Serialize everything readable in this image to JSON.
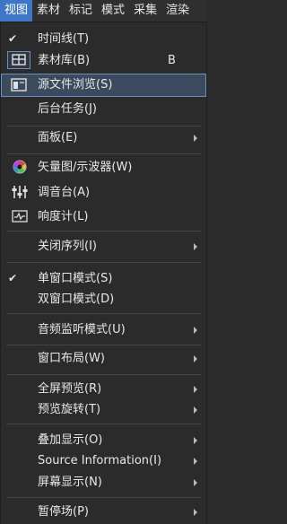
{
  "menubar": {
    "items": [
      "视图",
      "素材",
      "标记",
      "模式",
      "采集",
      "渲染"
    ],
    "active_index": 0
  },
  "menu": {
    "timeline": {
      "label": "时间线(T)",
      "checked": true
    },
    "bin": {
      "label": "素材库(B)",
      "shortcut": "B"
    },
    "source_browser": {
      "label": "源文件浏览(S)"
    },
    "background_tasks": {
      "label": "后台任务(J)"
    },
    "panels": {
      "label": "面板(E)"
    },
    "vectorscope": {
      "label": "矢量图/示波器(W)"
    },
    "audio_mixer": {
      "label": "调音台(A)"
    },
    "loudness_meter": {
      "label": "响度计(L)"
    },
    "close_sequence": {
      "label": "关闭序列(I)"
    },
    "single_window": {
      "label": "单窗口模式(S)",
      "checked": true
    },
    "dual_window": {
      "label": "双窗口模式(D)"
    },
    "audio_monitor": {
      "label": "音频监听模式(U)"
    },
    "window_layout": {
      "label": "窗口布局(W)"
    },
    "fullscreen_preview": {
      "label": "全屏预览(R)"
    },
    "preview_rotate": {
      "label": "预览旋转(T)"
    },
    "overlay_display": {
      "label": "叠加显示(O)"
    },
    "source_information": {
      "label": "Source Information(I)"
    },
    "screen_display": {
      "label": "屏幕显示(N)"
    },
    "pause_field": {
      "label": "暂停场(P)"
    }
  },
  "colors": {
    "menu_bg": "#2b2b2b",
    "highlight_bg": "#3c4a5e",
    "highlight_border": "#6e8fba",
    "active_menubar": "#3d77c6",
    "text": "#e8e8e8"
  }
}
